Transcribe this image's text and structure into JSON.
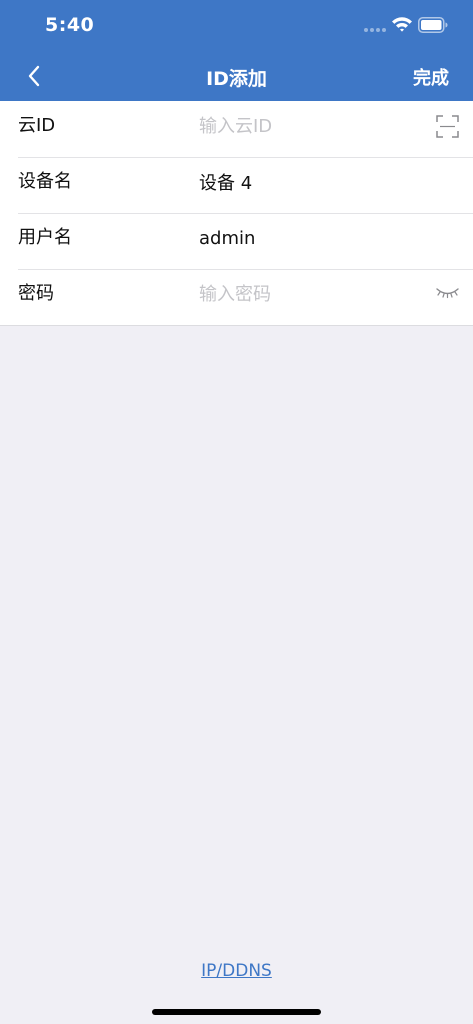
{
  "status_bar": {
    "time": "5:40"
  },
  "nav": {
    "title": "ID添加",
    "done_label": "完成"
  },
  "form": {
    "rows": [
      {
        "label": "云ID",
        "value": "",
        "placeholder": "输入云ID"
      },
      {
        "label": "设备名",
        "value": "设备 4",
        "placeholder": ""
      },
      {
        "label": "用户名",
        "value": "admin",
        "placeholder": ""
      },
      {
        "label": "密码",
        "value": "",
        "placeholder": "输入密码"
      }
    ]
  },
  "footer": {
    "link_label": "IP/DDNS"
  },
  "colors": {
    "header": "#3e77c6",
    "background": "#f0eff5",
    "link": "#3e77c6",
    "placeholder": "#c4c4c8"
  },
  "icons": [
    "back-chevron-icon",
    "wifi-icon",
    "battery-icon",
    "scan-icon",
    "eye-closed-icon"
  ]
}
